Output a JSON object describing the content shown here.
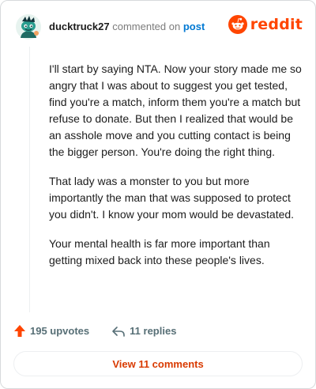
{
  "header": {
    "username": "ducktruck27",
    "commented": "commented on",
    "post_link": "post",
    "brand": "reddit",
    "brand_color": "#ff4500",
    "avatar_icon": "snoo-avatar-icon"
  },
  "comment": {
    "paragraphs": [
      "I'll start by saying NTA. Now your story made me so angry that I was about to suggest you get tested, find you're a match, inform them you're a match but refuse to donate. But then I realized that would be an asshole move and you cutting contact is being the bigger person. You're doing the right thing.",
      "That lady was a monster to you but more importantly the man that was supposed to protect you didn't. I know your mom would be devastated.",
      "Your mental health is far more important than getting mixed back into these people's lives."
    ]
  },
  "actions": {
    "upvotes": "195 upvotes",
    "replies": "11 replies",
    "upvote_icon": "upvote-arrow-icon",
    "reply_icon": "reply-icon",
    "upvote_color": "#ff4500"
  },
  "footer": {
    "view_comments": "View 11 comments",
    "link_color": "#d93a00"
  }
}
